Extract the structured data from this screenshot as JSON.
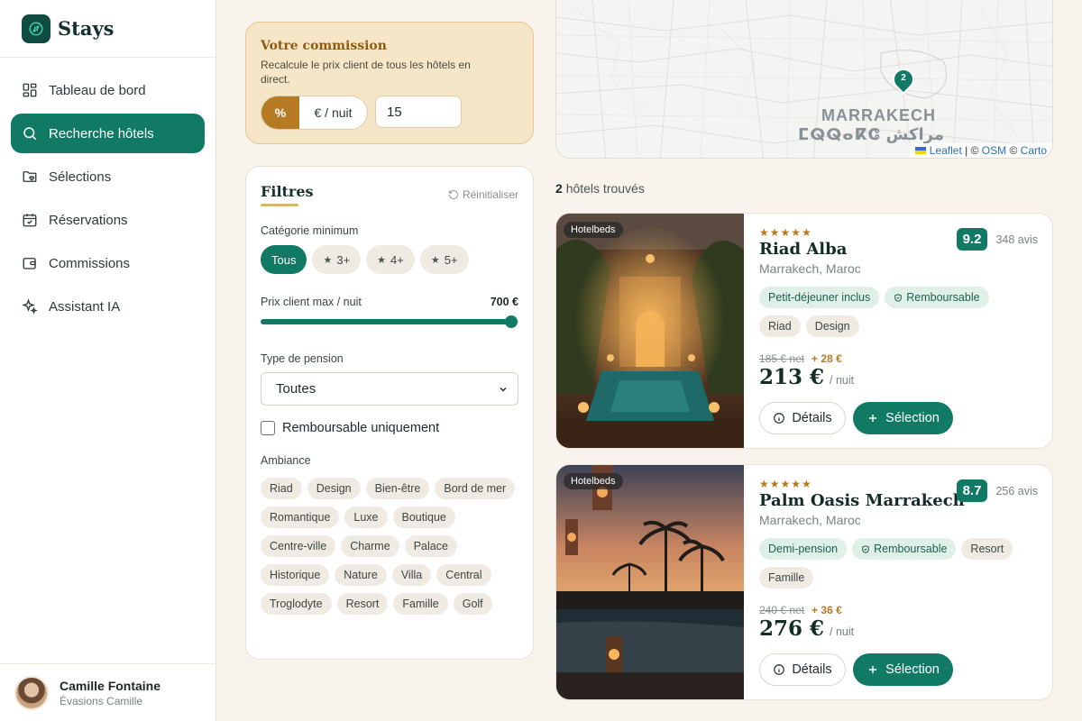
{
  "app": {
    "name": "Stays"
  },
  "nav": [
    {
      "label": "Tableau de bord",
      "icon": "dashboard-icon"
    },
    {
      "label": "Recherche hôtels",
      "icon": "search-icon",
      "active": true
    },
    {
      "label": "Sélections",
      "icon": "folder-heart-icon"
    },
    {
      "label": "Réservations",
      "icon": "calendar-check-icon"
    },
    {
      "label": "Commissions",
      "icon": "wallet-icon"
    },
    {
      "label": "Assistant IA",
      "icon": "sparkles-icon"
    }
  ],
  "user": {
    "name": "Camille Fontaine",
    "org": "Évasions Camille"
  },
  "commission": {
    "title": "Votre commission",
    "description": "Recalcule le prix client de tous les hôtels en direct.",
    "mode_percent": "%",
    "mode_per_night": "€ / nuit",
    "value": "15",
    "active_mode": "percent"
  },
  "filters": {
    "title": "Filtres",
    "reset_label": "Réinitialiser",
    "category_label": "Catégorie minimum",
    "categories": [
      "Tous",
      "3+",
      "4+",
      "5+"
    ],
    "category_selected": "Tous",
    "price_label": "Prix client max / nuit",
    "price_value": "700 €",
    "price_slider_fraction": 1.0,
    "board_label": "Type de pension",
    "board_value": "Toutes",
    "refundable_label": "Remboursable uniquement",
    "refundable_checked": false,
    "ambiance_label": "Ambiance",
    "ambiances": [
      "Riad",
      "Design",
      "Bien-être",
      "Bord de mer",
      "Romantique",
      "Luxe",
      "Boutique",
      "Centre-ville",
      "Charme",
      "Palace",
      "Historique",
      "Nature",
      "Villa",
      "Central",
      "Troglodyte",
      "Resort",
      "Famille",
      "Golf"
    ]
  },
  "map": {
    "city_label": "MARRAKECH",
    "city_label_local": "ⵎⵕⵕⴰⴽⵛ مراكش",
    "pin_count": "2",
    "attribution_leaflet": "Leaflet",
    "attribution_sep": "|",
    "attribution_osm": "OSM",
    "attribution_carto": "Carto"
  },
  "results": {
    "count": "2",
    "label": "hôtels trouvés"
  },
  "hotels": [
    {
      "source": "Hotelbeds",
      "stars": "★★★★★",
      "name": "Riad Alba",
      "city": "Marrakech, Maroc",
      "score": "9.2",
      "reviews": "348 avis",
      "features": [
        "Petit-déjeuner inclus",
        "Remboursable"
      ],
      "tags": [
        "Riad",
        "Design"
      ],
      "net_price": "185 € net",
      "markup": "+ 28 €",
      "price": "213 €",
      "per_night": "/ nuit",
      "details_label": "Détails",
      "select_label": "Sélection"
    },
    {
      "source": "Hotelbeds",
      "stars": "★★★★★",
      "name": "Palm Oasis Marrakech",
      "city": "Marrakech, Maroc",
      "score": "8.7",
      "reviews": "256 avis",
      "features": [
        "Demi-pension",
        "Remboursable"
      ],
      "tags": [
        "Resort",
        "Famille"
      ],
      "net_price": "240 € net",
      "markup": "+ 36 €",
      "price": "276 €",
      "per_night": "/ nuit",
      "details_label": "Détails",
      "select_label": "Sélection"
    }
  ],
  "colors": {
    "accent": "#117a64",
    "gold": "#b67a22",
    "background": "#f8f3ec"
  }
}
